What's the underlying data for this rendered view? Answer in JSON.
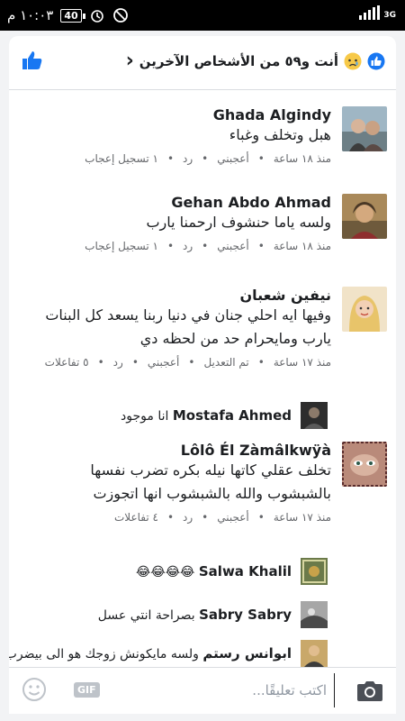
{
  "status_bar": {
    "time": "١٠:٠٣ م",
    "battery": "40",
    "network": "3G"
  },
  "header": {
    "reactions_title": "أنت و٥٩ من الأشخاص الآخرين"
  },
  "comments": [
    {
      "author": "Ghada Algindy",
      "text": "هبل وتخلف وغباء",
      "time": "منذ ١٨ ساعة",
      "like": "أعجبني",
      "reply": "رد",
      "likes_count": "١ تسجيل إعجاب"
    },
    {
      "author": "Gehan Abdo Ahmad",
      "text": "ولسه ياما حنشوف  ارحمنا يارب",
      "time": "منذ ١٨ ساعة",
      "like": "أعجبني",
      "reply": "رد",
      "likes_count": "١ تسجيل إعجاب"
    },
    {
      "author": "نيفين شعبان",
      "text_line1": "وفيها ايه احلي جنان في دنيا ربنا يسعد كل البنات",
      "text_line2": "يارب ومايحرام حد من لحظه دي",
      "time": "منذ ١٧ ساعة",
      "edited": "تم التعديل",
      "like": "أعجبني",
      "reply": "رد",
      "likes_count": "٥ تفاعلات"
    },
    {
      "author": "Lôlô Él Zàmâlkwÿà",
      "text_line1": "تخلف عقلي كاتها نيله بكره تضرب نفسها",
      "text_line2": "بالشبشوب والله بالشبشوب انها اتجوزت",
      "time": "منذ ١٧ ساعة",
      "like": "أعجبني",
      "reply": "رد",
      "likes_count": "٤ تفاعلات"
    }
  ],
  "replies": [
    {
      "author": "Mostafa Ahmed",
      "text": "انا موجود"
    },
    {
      "author": "Salwa Khalil",
      "text": "😂😂😂😂"
    },
    {
      "author": "Sabry Sabry",
      "text": "بصراحة انتي عسل"
    },
    {
      "author": "ابوانس رستم",
      "text": "ولسه مايكونش زوجك هو الى بيضرب..."
    }
  ],
  "composer": {
    "placeholder": "اكتب تعليقًا...",
    "gif_label": "GIF"
  },
  "colors": {
    "accent": "#1877f2",
    "meta": "#65676b"
  },
  "icons": [
    "like-thumb-icon",
    "chevron-right-icon",
    "sad-reaction-icon",
    "like-reaction-icon",
    "camera-icon",
    "gif-icon",
    "smiley-icon"
  ]
}
